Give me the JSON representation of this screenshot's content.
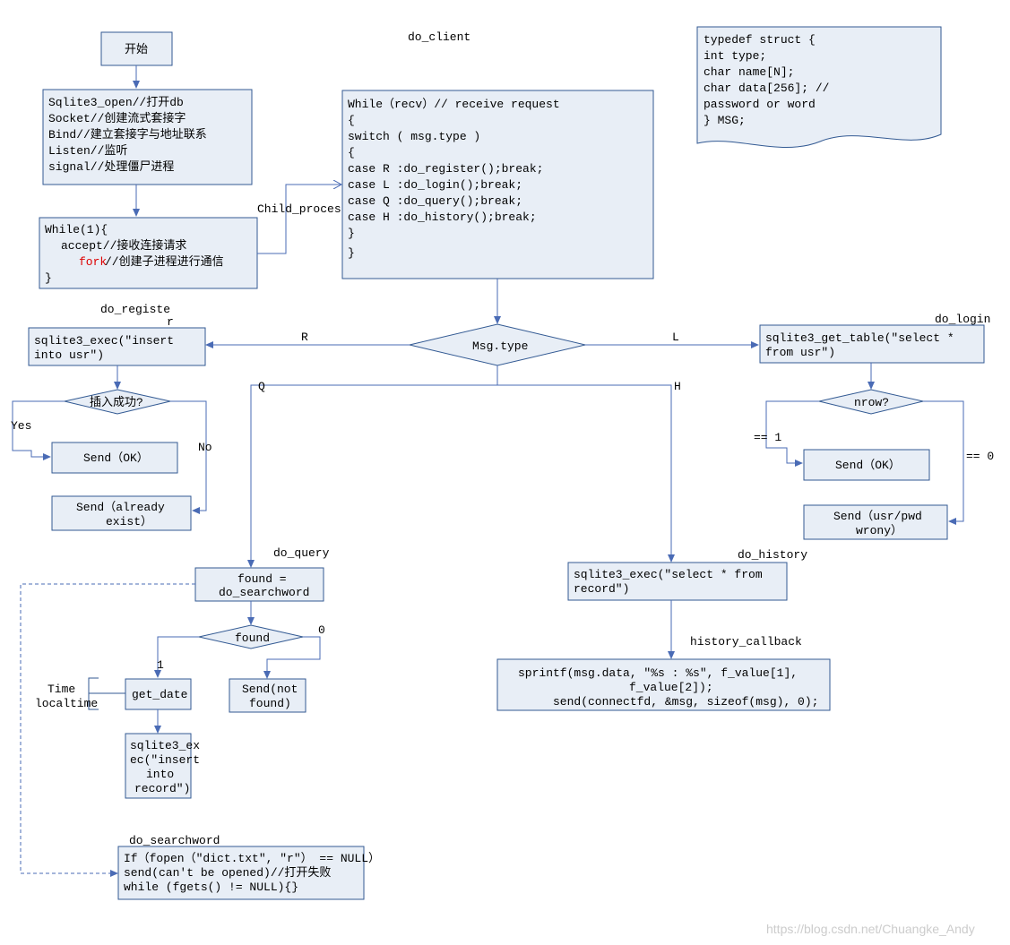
{
  "title_top": "do_client",
  "start": "开始",
  "init": [
    "Sqlite3_open//打开db",
    "Socket//创建流式套接字",
    "Bind//建立套接字与地址联系",
    "Listen//监听",
    "signal//处理僵尸进程"
  ],
  "while_loop": {
    "l1": "While(1){",
    "l2": "accept//接收连接请求",
    "fork_word": "fork",
    "l3_rest": "//创建子进程进行通信",
    "l4": "}"
  },
  "child_process_label": "Child_process",
  "recv_block": [
    "While（recv）// receive request",
    "{",
    "        switch ( msg.type )",
    "        {",
    "        case R :do_register();break;",
    "        case L :do_login();break;",
    "        case Q :do_query();break;",
    "        case H :do_history();break;",
    "        }",
    "}"
  ],
  "msg_type": "Msg.type",
  "branch_R": "R",
  "branch_L": "L",
  "branch_Q": "Q",
  "branch_H": "H",
  "do_register_label": "do_registe",
  "do_register_label2": "r",
  "do_register_exec": "sqlite3_exec(\"insert into usr\")",
  "insert_ok": "插入成功?",
  "yes": "Yes",
  "no": "No",
  "send_ok": "Send（OK）",
  "send_exist": "Send（already exist）",
  "do_login_label": "do_login",
  "do_login_exec": "sqlite3_get_table(\"select * from usr\")",
  "nrow": "nrow?",
  "eq1": "== 1",
  "eq0": "== 0",
  "send_ok2": "Send（OK）",
  "send_wrong": "Send（usr/pwd wrony）",
  "do_query_label": "do_query",
  "found_assign": "found = do_searchword",
  "found": "found",
  "one": "1",
  "zero": "0",
  "get_date": "get_date",
  "time_local": "Time localtime",
  "insert_record": "sqlite3_exec(\"insert into record\")",
  "send_not_found": "Send(not found)",
  "do_history_label": "do_history",
  "history_exec": "sqlite3_exec(\"select * from record\")",
  "history_cb": "history_callback",
  "history_sprintf": [
    "sprintf(msg.data, \"%s : %s\", f_value[1],",
    "f_value[2]);",
    "send(connectfd, &msg, sizeof(msg), 0);"
  ],
  "do_searchword_label": "do_searchword",
  "searchword_block": [
    "If（fopen（\"dict.txt\", \"r\"） == NULL）",
    "send(can't be opened)//打开失败",
    "while (fgets() != NULL){}"
  ],
  "typedef_block": [
    "typedef struct {",
    "        int type;",
    "        char name[N];",
    "        char data[256];   //",
    "password or word",
    "} MSG;"
  ],
  "watermark": "https://blog.csdn.net/Chuangke_Andy"
}
